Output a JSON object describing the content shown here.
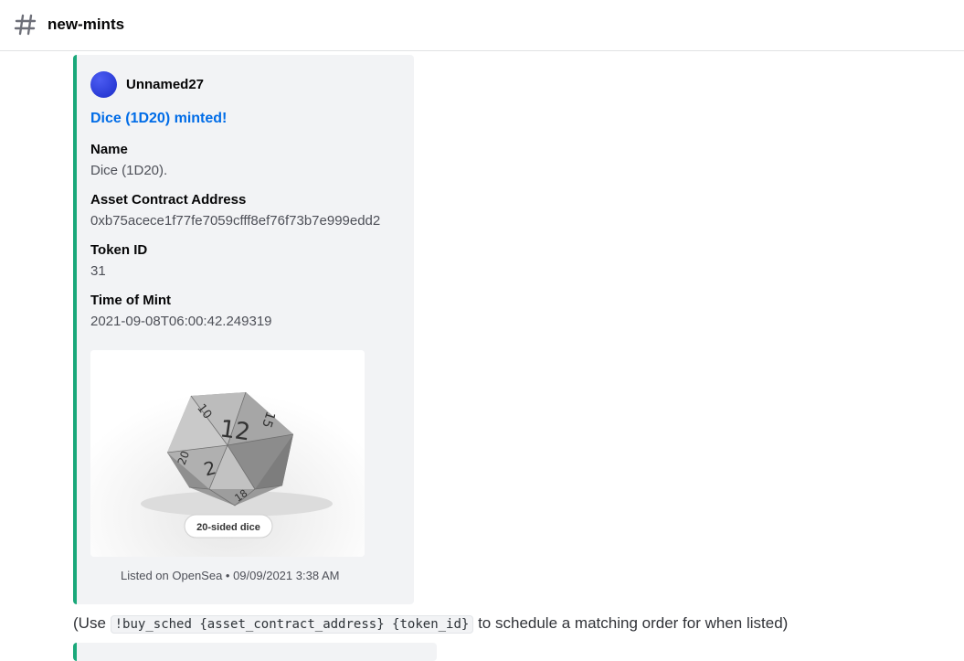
{
  "channel": {
    "icon": "hash-icon",
    "name": "new-mints"
  },
  "embed": {
    "accent_color": "#1aa87a",
    "author": {
      "name": "Unnamed27"
    },
    "title": "Dice (1D20) minted!",
    "fields": [
      {
        "name": "Name",
        "value": "Dice (1D20)."
      },
      {
        "name": "Asset Contract Address",
        "value": "0xb75acece1f77fe7059cfff8ef76f73b7e999edd2"
      },
      {
        "name": "Token ID",
        "value": "31"
      },
      {
        "name": "Time of Mint",
        "value": "2021-09-08T06:00:42.249319"
      }
    ],
    "image": {
      "die_faces": [
        "12",
        "10",
        "15",
        "2",
        "20",
        "18"
      ],
      "caption": "20-sided dice"
    },
    "footer": "Listed on OpenSea • 09/09/2021 3:38 AM"
  },
  "message": {
    "prefix": "(Use ",
    "code": "!buy_sched {asset_contract_address} {token_id}",
    "suffix": " to schedule a matching order for when listed)"
  }
}
